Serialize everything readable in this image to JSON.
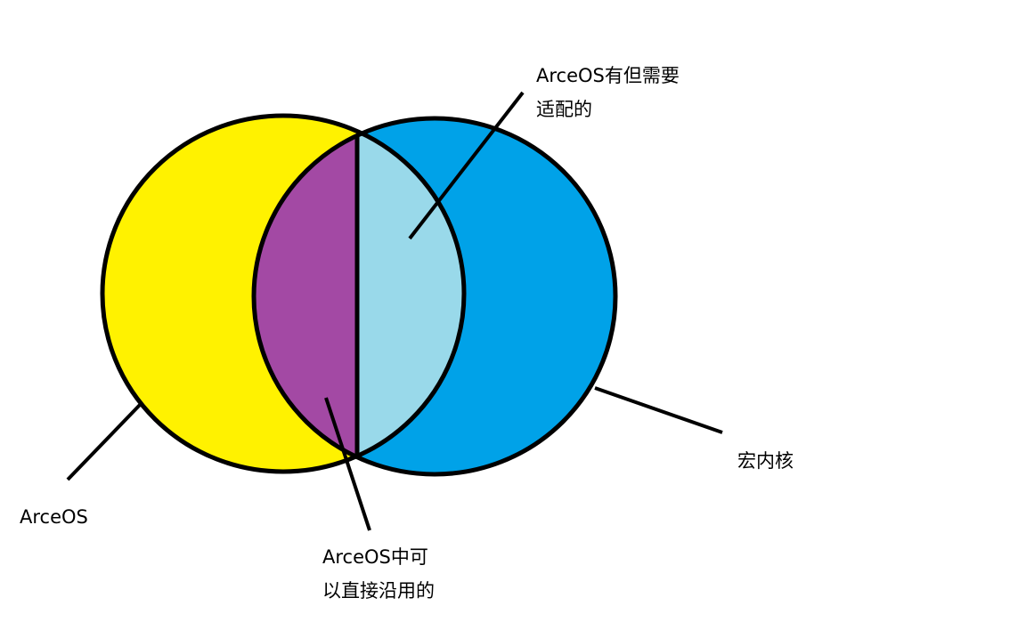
{
  "diagram": {
    "labels": {
      "arceos": "ArceOS",
      "macrokernel": "宏内核",
      "adapt": [
        "ArceOS有但需要",
        "适配的"
      ],
      "reuse": [
        "ArceOS中可",
        "以直接沿用的"
      ]
    },
    "colors": {
      "arceos_only": "#fff200",
      "macrokernel_only": "#00a2e8",
      "reuse_directly": "#a349a4",
      "needs_adaptation": "#99d9ea",
      "outline": "#000000"
    }
  }
}
